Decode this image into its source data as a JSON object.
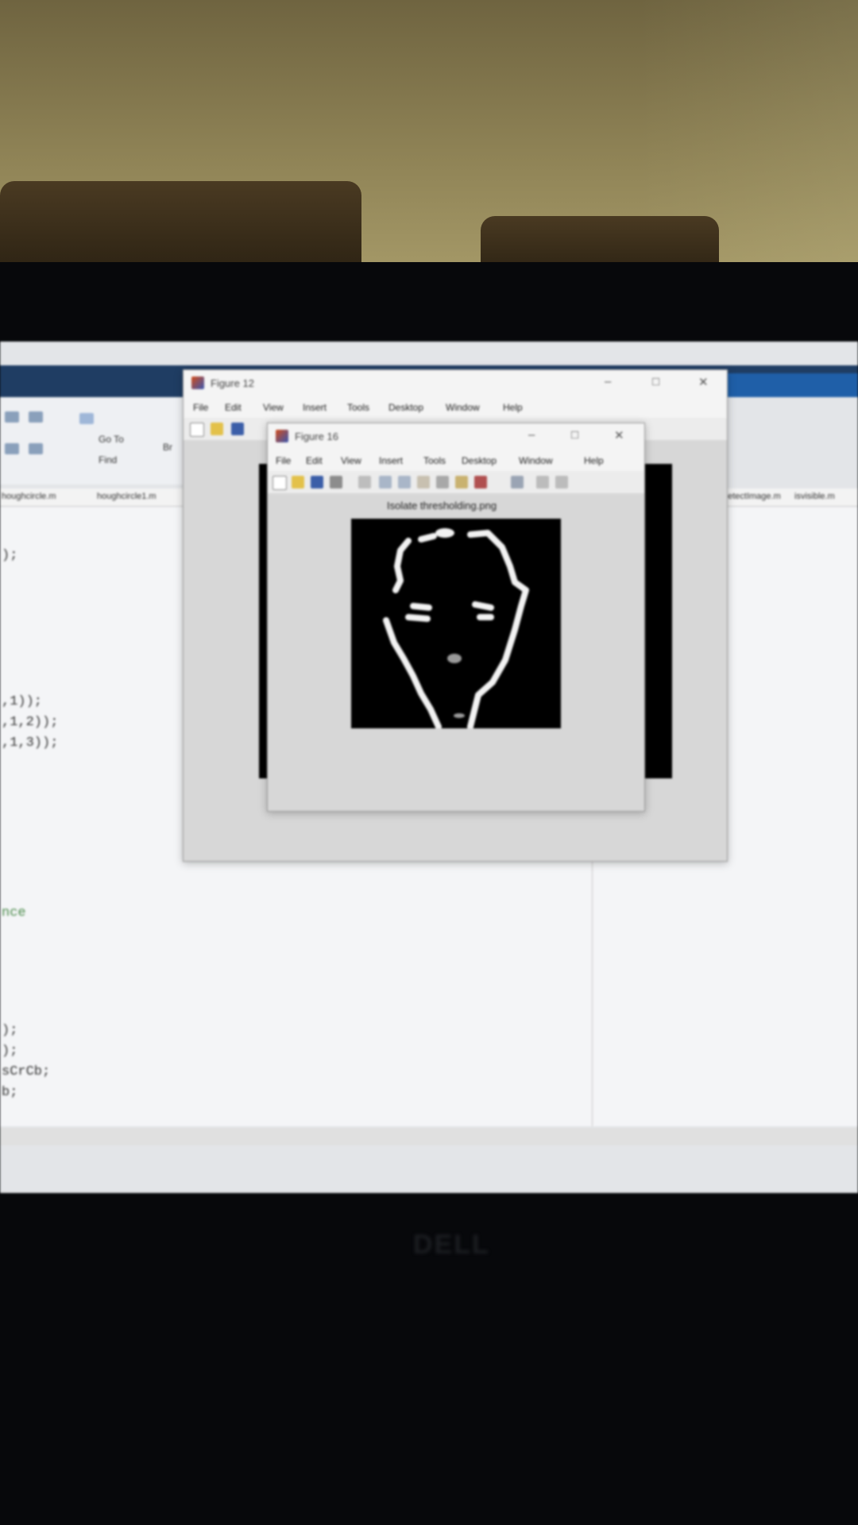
{
  "editor": {
    "tabs": [
      "houghcircle.m",
      "houghcircle1.m",
      "detectImage.m",
      "isvisible.m"
    ],
    "code_lines": [
      {
        "text": "",
        "top": 0
      },
      {
        "text": ");",
        "top": 0
      },
      {
        "text": ",1));",
        "top": 0
      },
      {
        "text": ",1,2));",
        "top": 0
      },
      {
        "text": ",1,3));",
        "top": 0
      },
      {
        "text": "nce",
        "top": 0
      },
      {
        "text": ");",
        "top": 0
      },
      {
        "text": ");",
        "top": 0
      },
      {
        "text": "sCrCb;",
        "top": 0
      },
      {
        "text": "b;",
        "top": 0
      }
    ],
    "ribbon": {
      "goto_label": "Go To",
      "find_label": "Find",
      "br_label": "Br"
    }
  },
  "figure_back": {
    "title": "Figure 12",
    "menu": [
      "File",
      "Edit",
      "View",
      "Insert",
      "Tools",
      "Desktop",
      "Window",
      "Help"
    ]
  },
  "figure_front": {
    "title": "Figure 16",
    "menu": [
      "File",
      "Edit",
      "View",
      "Insert",
      "Tools",
      "Desktop",
      "Window",
      "Help"
    ],
    "axes_title": "Isolate thresholding.png",
    "image_icon": "face-edge-image"
  },
  "monitor": {
    "brand": "DELL"
  },
  "colors": {
    "matlab_blue": "#1f3d63",
    "figure_gray": "#cfcfcf",
    "accent_blue": "#1f5fa8"
  }
}
